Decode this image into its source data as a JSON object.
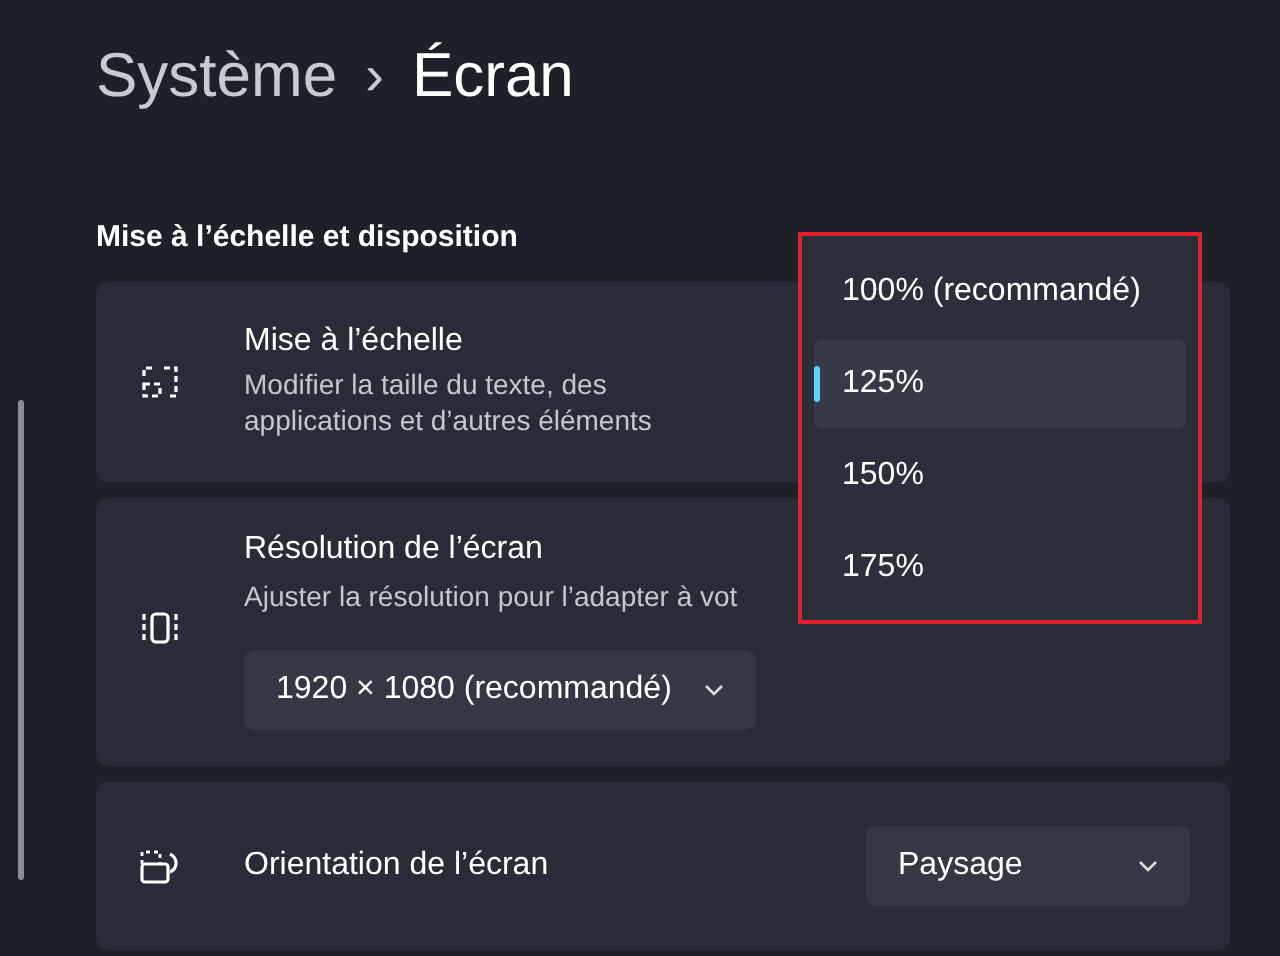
{
  "breadcrumb": {
    "parent": "Système",
    "separator": "›",
    "current": "Écran"
  },
  "section_title": "Mise à l’échelle et disposition",
  "settings": [
    {
      "kind": "plain",
      "title": "Mise à l’échelle",
      "description": "Modifier la taille du texte, des applications et d’autres éléments"
    },
    {
      "kind": "below",
      "title": "Résolution de l’écran",
      "description": "Ajuster la résolution pour l’adapter à  vot",
      "dropdown": "1920 × 1080 (recommandé)"
    },
    {
      "kind": "side",
      "title": "Orientation de l’écran",
      "dropdown": "Paysage"
    }
  ],
  "scale_menu": {
    "highlighted": true,
    "options": [
      {
        "label": "100% (recommandé)",
        "selected": false
      },
      {
        "label": "125%",
        "selected": true
      },
      {
        "label": "150%",
        "selected": false
      },
      {
        "label": "175%",
        "selected": false
      }
    ]
  }
}
